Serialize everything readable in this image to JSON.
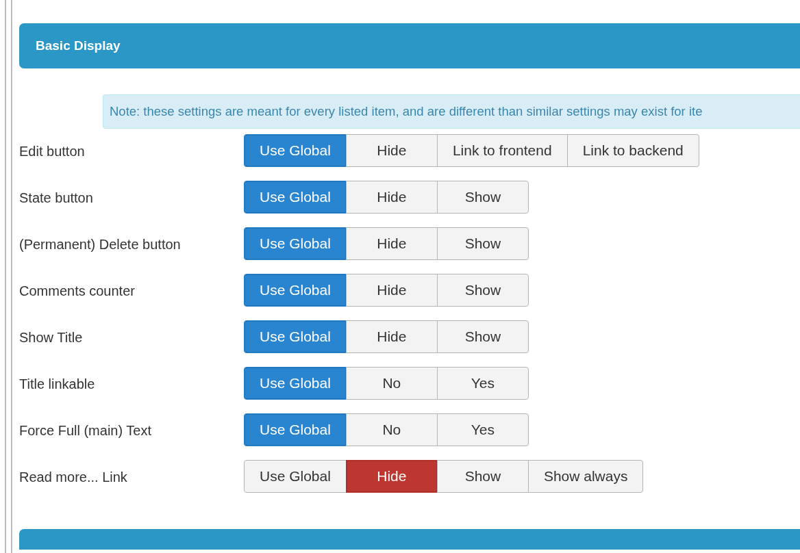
{
  "panel": {
    "title": "Basic Display"
  },
  "note": "Note: these settings are meant for every listed item, and are different than similar settings may exist for ite",
  "settings": [
    {
      "label": "Edit button",
      "options": [
        {
          "label": "Use Global",
          "selected": true,
          "color": "#2a85d0"
        },
        {
          "label": "Hide",
          "selected": false
        },
        {
          "label": "Link to frontend",
          "selected": false
        },
        {
          "label": "Link to backend",
          "selected": false
        }
      ]
    },
    {
      "label": "State button",
      "options": [
        {
          "label": "Use Global",
          "selected": true,
          "color": "#2a85d0"
        },
        {
          "label": "Hide",
          "selected": false
        },
        {
          "label": "Show",
          "selected": false
        }
      ]
    },
    {
      "label": "(Permanent) Delete button",
      "options": [
        {
          "label": "Use Global",
          "selected": true,
          "color": "#2a85d0"
        },
        {
          "label": "Hide",
          "selected": false
        },
        {
          "label": "Show",
          "selected": false
        }
      ]
    },
    {
      "label": "Comments counter",
      "options": [
        {
          "label": "Use Global",
          "selected": true,
          "color": "#2a85d0"
        },
        {
          "label": "Hide",
          "selected": false
        },
        {
          "label": "Show",
          "selected": false
        }
      ]
    },
    {
      "label": "Show Title",
      "options": [
        {
          "label": "Use Global",
          "selected": true,
          "color": "#2a85d0"
        },
        {
          "label": "Hide",
          "selected": false
        },
        {
          "label": "Show",
          "selected": false
        }
      ]
    },
    {
      "label": "Title linkable",
      "options": [
        {
          "label": "Use Global",
          "selected": true,
          "color": "#2a85d0"
        },
        {
          "label": "No",
          "selected": false
        },
        {
          "label": "Yes",
          "selected": false
        }
      ]
    },
    {
      "label": "Force Full (main) Text",
      "options": [
        {
          "label": "Use Global",
          "selected": true,
          "color": "#2a85d0"
        },
        {
          "label": "No",
          "selected": false
        },
        {
          "label": "Yes",
          "selected": false
        }
      ]
    },
    {
      "label": "Read more... Link",
      "options": [
        {
          "label": "Use Global",
          "selected": false
        },
        {
          "label": "Hide",
          "selected": true,
          "color": "#bd362f"
        },
        {
          "label": "Show",
          "selected": false
        },
        {
          "label": "Show always",
          "selected": false
        }
      ]
    }
  ]
}
